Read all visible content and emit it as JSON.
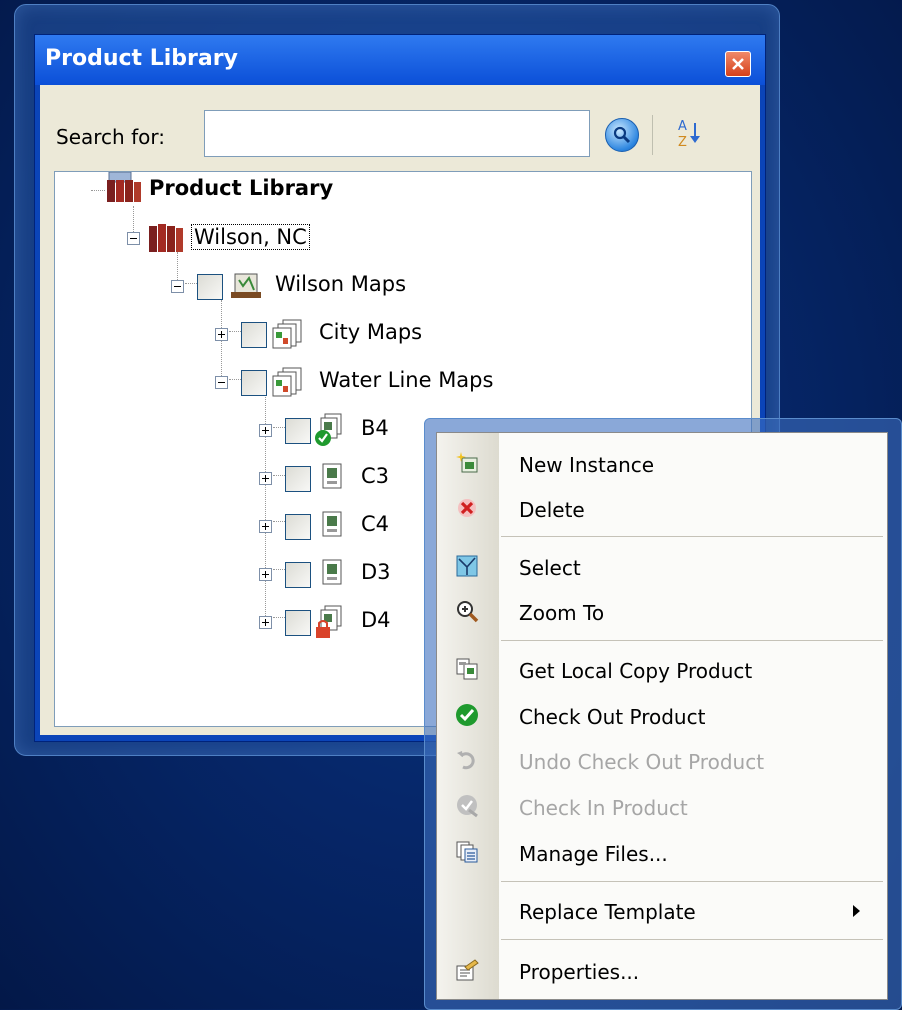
{
  "window": {
    "title": "Product Library"
  },
  "search": {
    "label": "Search for:",
    "value": "",
    "placeholder": ""
  },
  "tree": {
    "root": "Product Library",
    "library": "Wilson, NC",
    "folder": "Wilson Maps",
    "groups": [
      "City Maps",
      "Water Line Maps"
    ],
    "products": [
      "B4",
      "C3",
      "C4",
      "D3",
      "D4"
    ]
  },
  "context_menu": {
    "items": [
      {
        "label": "New Instance",
        "icon": "new-instance-icon",
        "enabled": true
      },
      {
        "label": "Delete",
        "icon": "delete-icon",
        "enabled": true
      },
      {
        "label": "Select",
        "icon": "select-icon",
        "enabled": true
      },
      {
        "label": "Zoom To",
        "icon": "zoom-to-icon",
        "enabled": true
      },
      {
        "label": "Get Local Copy Product",
        "icon": "local-copy-icon",
        "enabled": true
      },
      {
        "label": "Check Out Product",
        "icon": "check-out-icon",
        "enabled": true
      },
      {
        "label": "Undo Check Out Product",
        "icon": "undo-check-out-icon",
        "enabled": false
      },
      {
        "label": "Check In Product",
        "icon": "check-in-icon",
        "enabled": false
      },
      {
        "label": "Manage Files...",
        "icon": "manage-files-icon",
        "enabled": true
      },
      {
        "label": "Replace Template",
        "icon": "",
        "enabled": true,
        "submenu": true
      },
      {
        "label": "Properties...",
        "icon": "properties-icon",
        "enabled": true
      }
    ]
  },
  "colors": {
    "titlebar": "#0b4fd8",
    "client": "#ece9d8",
    "background": "#06276a",
    "check_green": "#1f9a2e",
    "lock_red": "#d9432a"
  }
}
